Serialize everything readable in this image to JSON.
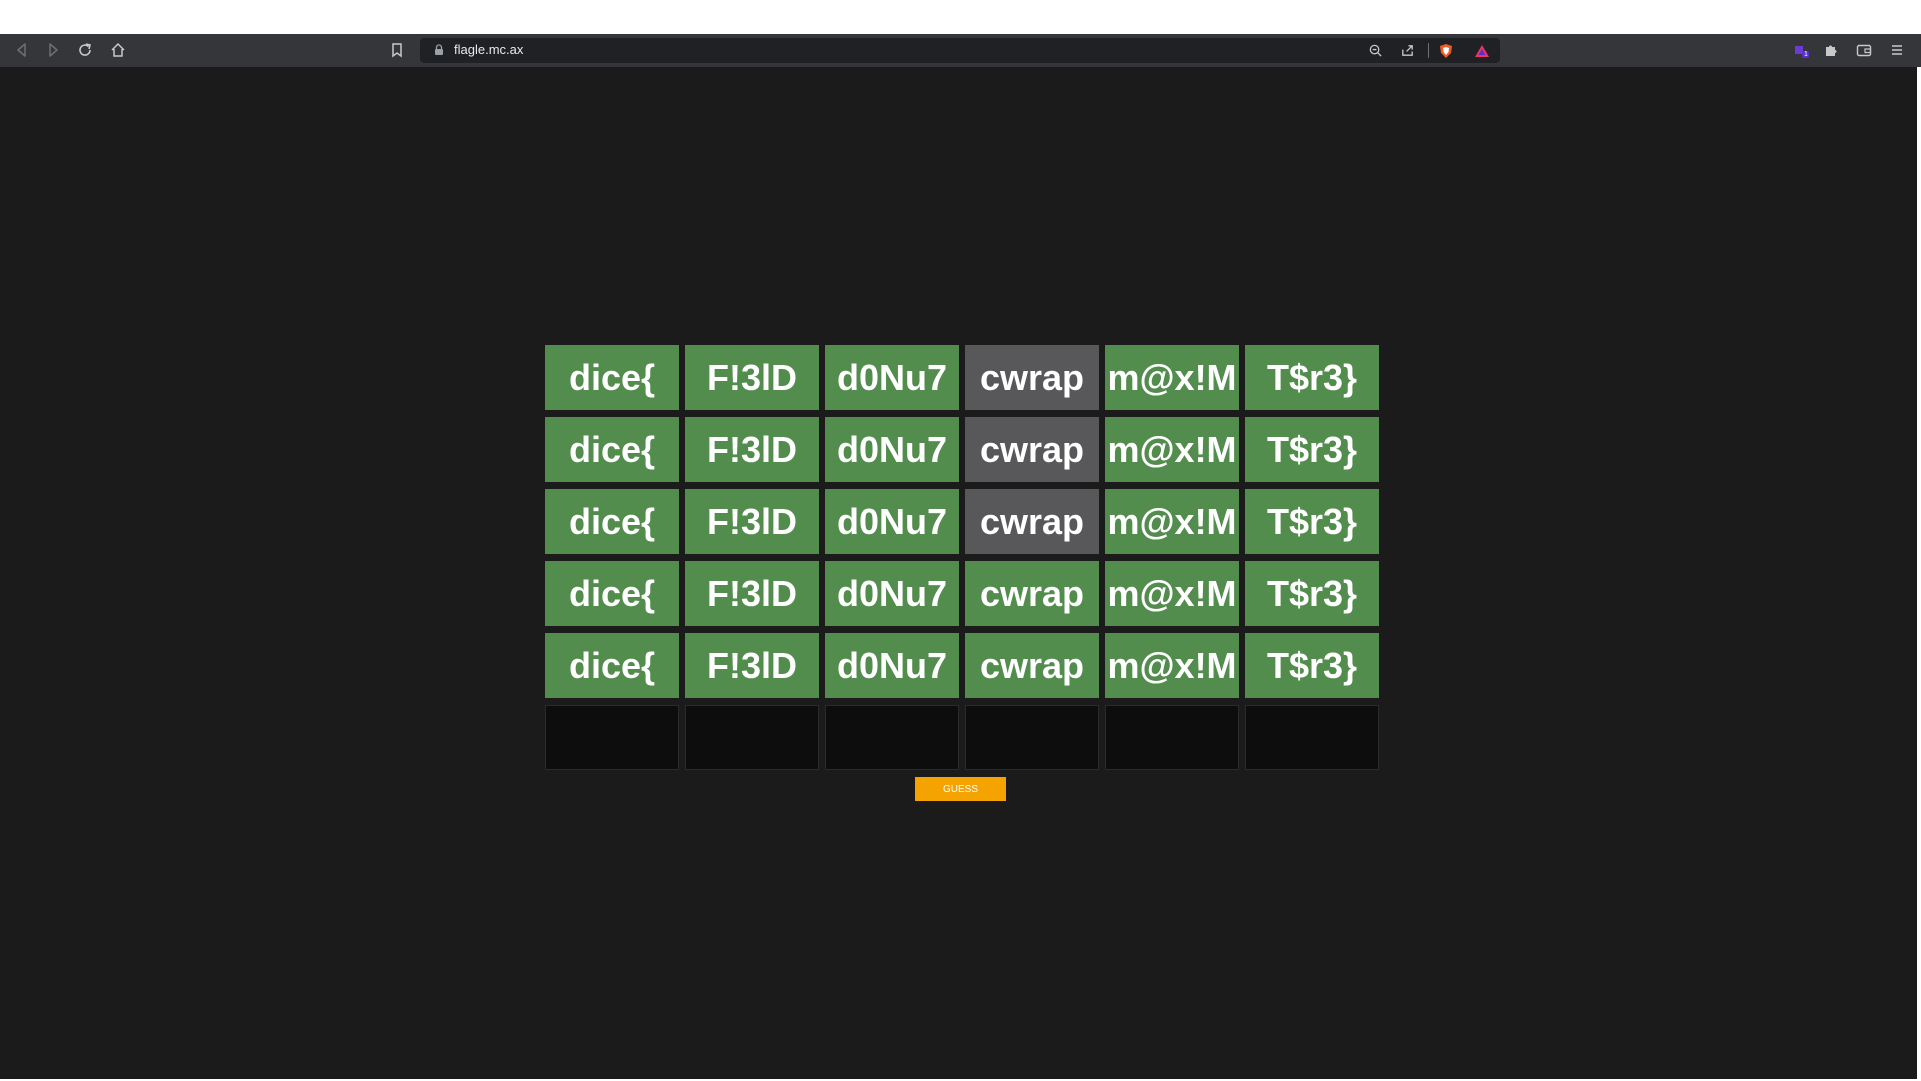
{
  "browser": {
    "url": "flagle.mc.ax",
    "extension_badge": "1"
  },
  "board": {
    "rows": [
      [
        {
          "text": "dice{",
          "state": "correct"
        },
        {
          "text": "F!3lD",
          "state": "correct"
        },
        {
          "text": "d0Nu7",
          "state": "correct"
        },
        {
          "text": "cwrap",
          "state": "absent"
        },
        {
          "text": "m@x!M",
          "state": "correct"
        },
        {
          "text": "T$r3}",
          "state": "correct"
        }
      ],
      [
        {
          "text": "dice{",
          "state": "correct"
        },
        {
          "text": "F!3lD",
          "state": "correct"
        },
        {
          "text": "d0Nu7",
          "state": "correct"
        },
        {
          "text": "cwrap",
          "state": "absent"
        },
        {
          "text": "m@x!M",
          "state": "correct"
        },
        {
          "text": "T$r3}",
          "state": "correct"
        }
      ],
      [
        {
          "text": "dice{",
          "state": "correct"
        },
        {
          "text": "F!3lD",
          "state": "correct"
        },
        {
          "text": "d0Nu7",
          "state": "correct"
        },
        {
          "text": "cwrap",
          "state": "absent"
        },
        {
          "text": "m@x!M",
          "state": "correct"
        },
        {
          "text": "T$r3}",
          "state": "correct"
        }
      ],
      [
        {
          "text": "dice{",
          "state": "correct"
        },
        {
          "text": "F!3lD",
          "state": "correct"
        },
        {
          "text": "d0Nu7",
          "state": "correct"
        },
        {
          "text": "cwrap",
          "state": "correct"
        },
        {
          "text": "m@x!M",
          "state": "correct"
        },
        {
          "text": "T$r3}",
          "state": "correct"
        }
      ],
      [
        {
          "text": "dice{",
          "state": "correct"
        },
        {
          "text": "F!3lD",
          "state": "correct"
        },
        {
          "text": "d0Nu7",
          "state": "correct"
        },
        {
          "text": "cwrap",
          "state": "correct"
        },
        {
          "text": "m@x!M",
          "state": "correct"
        },
        {
          "text": "T$r3}",
          "state": "correct"
        }
      ],
      [
        {
          "text": "",
          "state": "empty"
        },
        {
          "text": "",
          "state": "empty"
        },
        {
          "text": "",
          "state": "empty"
        },
        {
          "text": "",
          "state": "empty"
        },
        {
          "text": "",
          "state": "empty"
        },
        {
          "text": "",
          "state": "empty"
        }
      ]
    ]
  },
  "guess_button": {
    "label": "GUESS"
  },
  "colors": {
    "correct": "#538d4e",
    "absent": "#58585a",
    "empty": "#0d0d0d",
    "button": "#f5a300",
    "page_background": "#1b1b1b",
    "toolbar": "#35363a"
  }
}
